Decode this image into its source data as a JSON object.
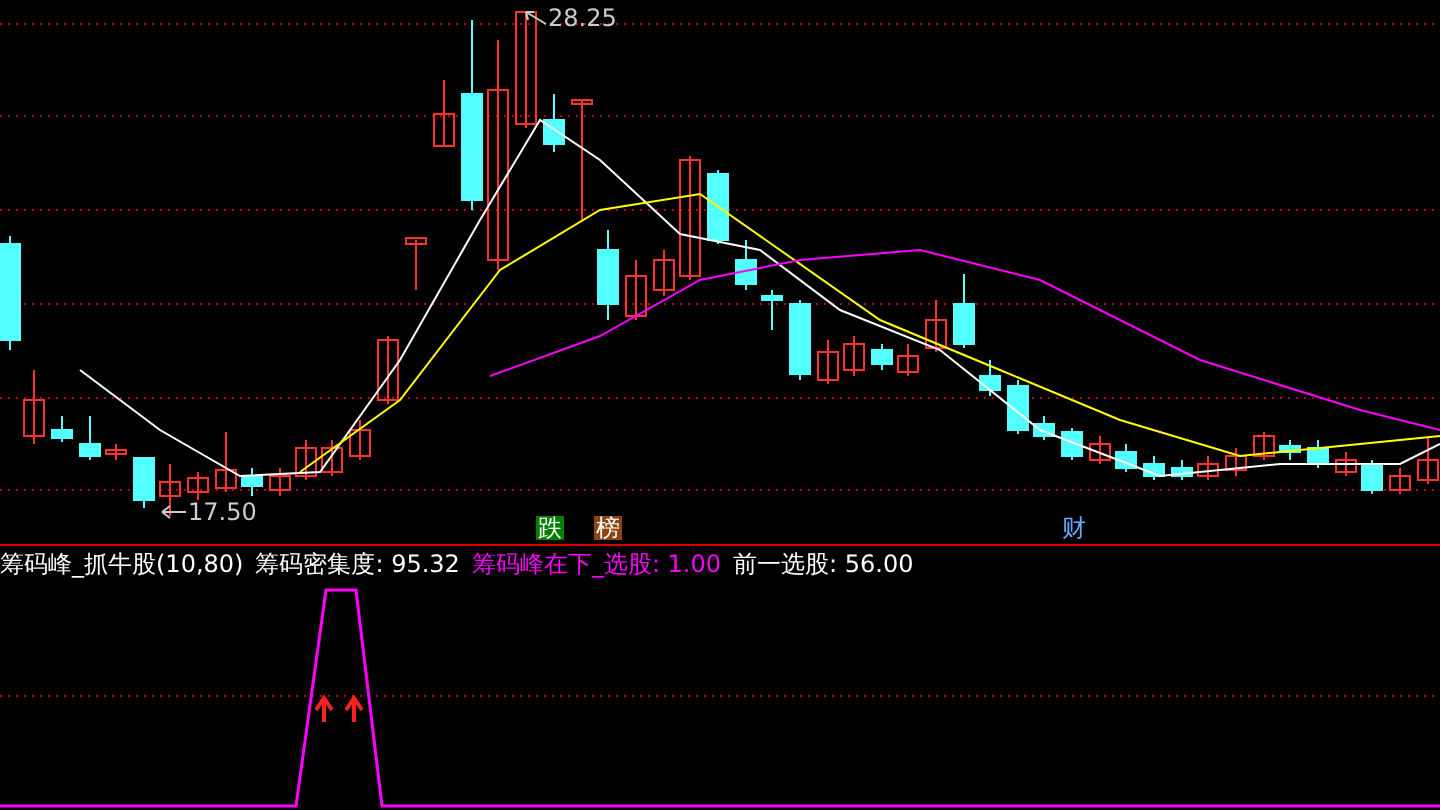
{
  "price_chart": {
    "high_label": "28.25",
    "low_label": "17.50",
    "event_badges": [
      {
        "text": "跌",
        "color": "#008000"
      },
      {
        "text": "榜",
        "color": "#8b4513"
      },
      {
        "text": "财",
        "color": "#6fa8ff"
      }
    ]
  },
  "indicator_panel": {
    "readouts": [
      {
        "text": "筹码峰_抓牛股(10,80)",
        "color": "#ffffff"
      },
      {
        "text": "筹码密集度: 95.32",
        "color": "#ffffff"
      },
      {
        "text": "筹码峰在下_选股: 1.00",
        "color": "#ff00ff"
      },
      {
        "text": "前一选股: 56.00",
        "color": "#ffffff"
      }
    ]
  }
}
